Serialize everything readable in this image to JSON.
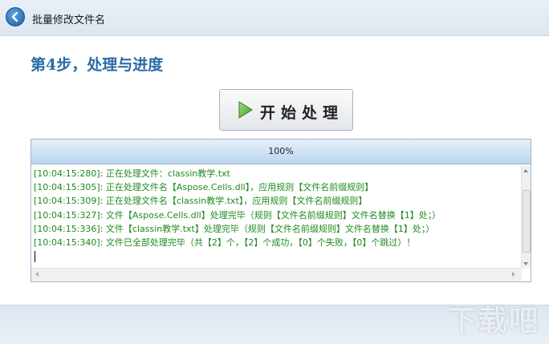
{
  "window": {
    "title": "批量修改文件名",
    "back_icon": "back-arrow-icon"
  },
  "step": {
    "title": "第4步，处理与进度"
  },
  "start_button": {
    "label": "开始处理",
    "icon": "play-icon"
  },
  "progress": {
    "percent_text": "100%",
    "value": 1.0
  },
  "log": {
    "lines": [
      "[10:04:15:280]: 正在处理文件：classin教学.txt",
      "[10:04:15:305]: 正在处理文件名【Aspose.Cells.dll】，应用规则【文件名前缀规则】",
      "[10:04:15:309]: 正在处理文件名【classin教学.txt】，应用规则【文件名前缀规则】",
      "[10:04:15:327]: 文件【Aspose.Cells.dll】处理完毕（规则【文件名前缀规则】文件名替换【1】处；）",
      "[10:04:15:336]: 文件【classin教学.txt】处理完毕（规则【文件名前缀规则】文件名替换【1】处；）",
      "[10:04:15:340]: 文件已全部处理完毕（共【2】个，【2】个成功，【0】个失败，【0】个跳过）！"
    ],
    "text_color": "#1e8a1e"
  },
  "watermark": {
    "text": "下载吧"
  },
  "colors": {
    "accent": "#2c6aa6",
    "titlebar": "#e3eaf3",
    "progress": "#bcd6f0"
  }
}
